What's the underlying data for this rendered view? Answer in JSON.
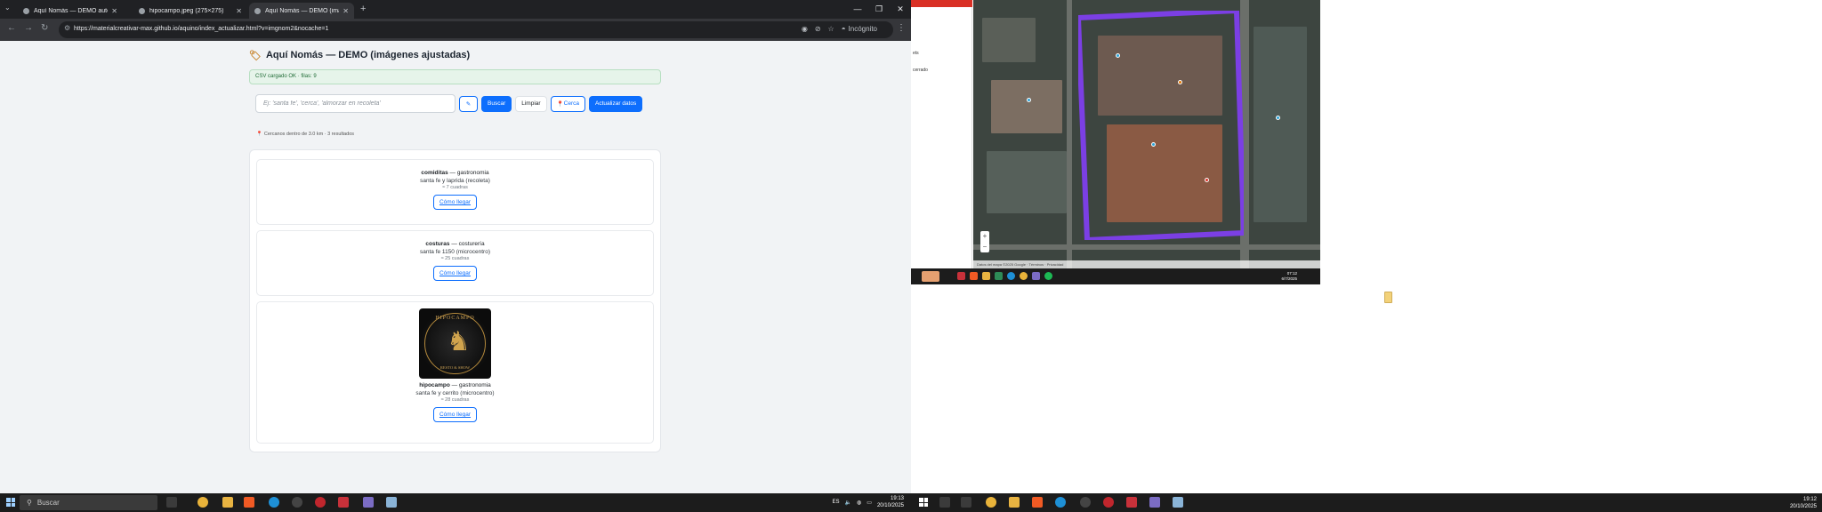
{
  "browser": {
    "tabs": [
      {
        "title": "Aquí Nomás — DEMO auto-cr",
        "active": false
      },
      {
        "title": "hipocampo.jpeg (275×275)",
        "active": false
      },
      {
        "title": "Aquí Nomás — DEMO (imágen",
        "active": true
      }
    ],
    "url": "https://materialcreativar-max.github.io/aquino/index_actualizar.html?v=imgnom2&nocache=1",
    "incognito_label": "Incógnito"
  },
  "app": {
    "title": "Aquí Nomás — DEMO (imágenes ajustadas)",
    "status": "CSV cargado OK · filas: 9",
    "search": {
      "placeholder": "Ej: 'santa fe', 'cerca', 'almorzar en recoleta'",
      "buscar_label": "Buscar",
      "limpiar_label": "Limpiar",
      "cerca_label": "Cerca",
      "actualizar_label": "Actualizar datos"
    },
    "result_note": "Cercanos dentro de 3.0 km · 3 resultados",
    "results": [
      {
        "name": "comiditas",
        "category": "gastronomia",
        "address": "santa fe y laprida (recoleta)",
        "distance": "≈ 7 cuadras",
        "route_label": "Cómo llegar"
      },
      {
        "name": "costuras",
        "category": "costurería",
        "address": "santa fe 1150 (microcentro)",
        "distance": "≈ 25 cuadras",
        "route_label": "Cómo llegar"
      },
      {
        "name": "hipocampo",
        "category": "gastronomia",
        "address": "santa fe y cerrito (microcentro)",
        "distance": "≈ 28 cuadras",
        "route_label": "Cómo llegar",
        "has_logo": true,
        "logo_text_top": "HIPOCAMPO",
        "logo_text_bottom": "RESTO & SHOW"
      }
    ]
  },
  "taskbar_left": {
    "search_label": "Buscar",
    "lang": "ES",
    "time": "19:13",
    "date": "20/10/2025"
  },
  "right_screen": {
    "side_panel_lines": [
      "ets",
      "cerrado"
    ],
    "map_footer": "Datos del mapa ©2025 Google · Términos · Privacidad",
    "taskbar_time": "19:12",
    "taskbar_date": "20/10/2025",
    "inner_time": "07:12",
    "inner_date": "6/7/2025"
  },
  "colors": {
    "primary": "#0d6efd",
    "polygon": "#7b3fe4",
    "status_bg": "#e6f4ea"
  }
}
